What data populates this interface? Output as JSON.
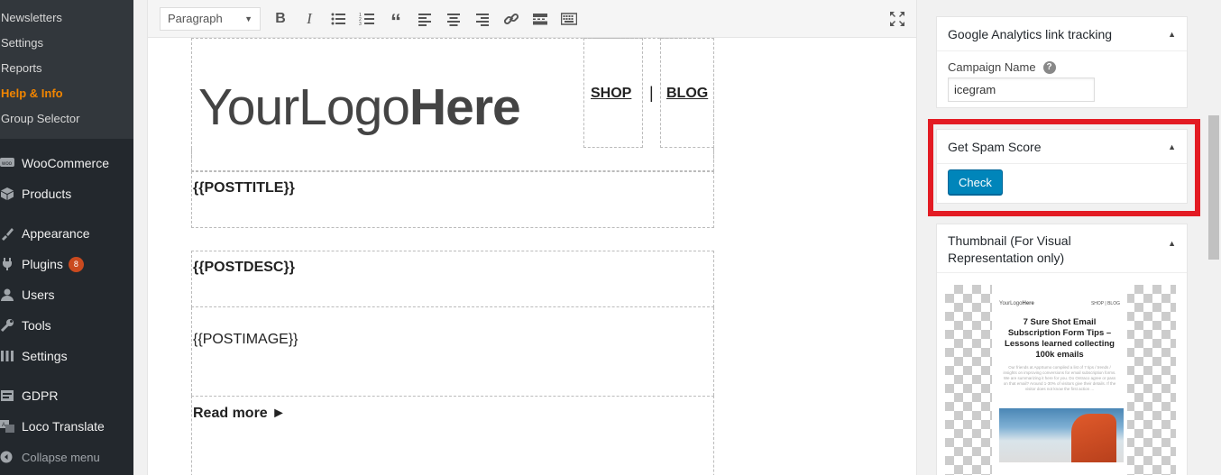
{
  "sidebar": {
    "submenu": [
      {
        "label": "Newsletters"
      },
      {
        "label": "Settings"
      },
      {
        "label": "Reports"
      },
      {
        "label": "Help & Info",
        "current": true
      },
      {
        "label": "Group Selector"
      }
    ],
    "menu": [
      {
        "label": "WooCommerce",
        "icon": "woo-icon"
      },
      {
        "label": "Products",
        "icon": "products-icon"
      },
      {
        "label": "Appearance",
        "icon": "appearance-icon"
      },
      {
        "label": "Plugins",
        "icon": "plugins-icon",
        "badge": "8"
      },
      {
        "label": "Users",
        "icon": "users-icon"
      },
      {
        "label": "Tools",
        "icon": "tools-icon"
      },
      {
        "label": "Settings",
        "icon": "settings-icon"
      },
      {
        "label": "GDPR",
        "icon": "gdpr-icon"
      },
      {
        "label": "Loco Translate",
        "icon": "translate-icon"
      }
    ],
    "collapse_label": "Collapse menu"
  },
  "editor": {
    "format_select": "Paragraph",
    "logo_light": "YourLogo",
    "logo_bold": "Here",
    "nav_shop": "SHOP",
    "nav_sep": "|",
    "nav_blog": "BLOG",
    "post_title": "{{POSTTITLE}}",
    "post_desc": "{{POSTDESC}}",
    "post_image": "{{POSTIMAGE}}",
    "read_more": "Read more ►"
  },
  "ga_box": {
    "title": "Google Analytics link tracking",
    "campaign_label": "Campaign Name",
    "campaign_value": "icegram"
  },
  "spam_box": {
    "title": "Get Spam Score",
    "check_label": "Check"
  },
  "thumb_box": {
    "title": "Thumbnail (For Visual Representation only)",
    "preview_logo_light": "YourLogo",
    "preview_logo_bold": "Here",
    "preview_nav": "SHOP  |  BLOG",
    "preview_title": "7 Sure Shot Email Subscription Form Tips – Lessons learned collecting 100k emails",
    "preview_text": "Our friends at AppSumo compiled a list of 7 tips / trends / insights on improving conversions for email subscription forms. We are summarizing it here for you. Do Ontraco agree or pass on that email? Around 1-30% of visitors give their details. If the visitor does not know the first action ..."
  },
  "colors": {
    "sidebar_bg": "#23282d",
    "accent_orange": "#f18500",
    "button_blue": "#0085ba",
    "highlight_red": "#e31b23"
  }
}
